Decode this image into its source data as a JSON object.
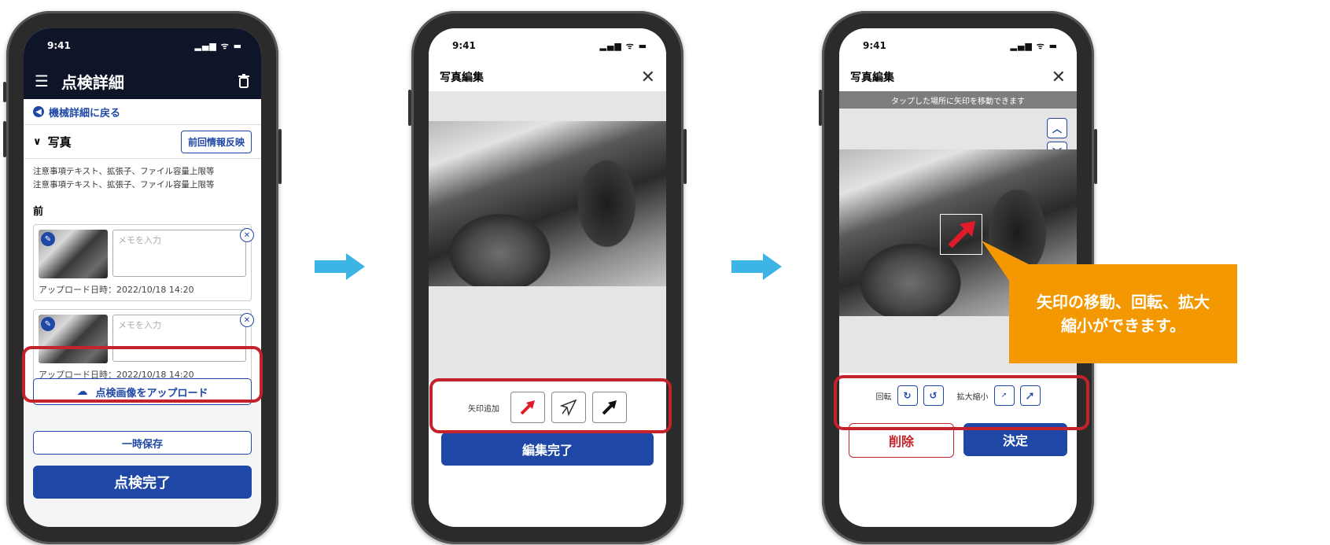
{
  "phone1": {
    "time": "9:41",
    "header_title": "点検詳細",
    "back_link": "機械詳細に戻る",
    "section_label": "写真",
    "reflect_button": "前回情報反映",
    "notes": [
      "注意事項テキスト、拡張子、ファイル容量上限等",
      "注意事項テキスト、拡張子、ファイル容量上限等"
    ],
    "front_label": "前",
    "photos": [
      {
        "memo_placeholder": "メモを入力",
        "upload_time": "アップロード日時：2022/10/18 14:20"
      },
      {
        "memo_placeholder": "メモを入力",
        "upload_time": "アップロード日時：2022/10/18 14:20"
      }
    ],
    "upload_button": "点検画像をアップロード",
    "temp_save_button": "一時保存",
    "complete_button": "点検完了"
  },
  "phone2": {
    "time": "9:41",
    "header_title": "写真編集",
    "arrow_add_label": "矢印追加",
    "done_button": "編集完了"
  },
  "phone3": {
    "time": "9:41",
    "header_title": "写真編集",
    "hint": "タップした場所に矢印を移動できます",
    "rotate_label": "回転",
    "scale_label": "拡大縮小",
    "delete_button": "削除",
    "confirm_button": "決定"
  },
  "callout": {
    "line1": "矢印の移動、回転、拡大",
    "line2": "縮小ができます。"
  },
  "colors": {
    "navy": "#0e1529",
    "primary": "#1f48a6",
    "frame_red": "#c4232c",
    "callout_orange": "#f39800",
    "flow_arrow": "#3cb4e6"
  }
}
